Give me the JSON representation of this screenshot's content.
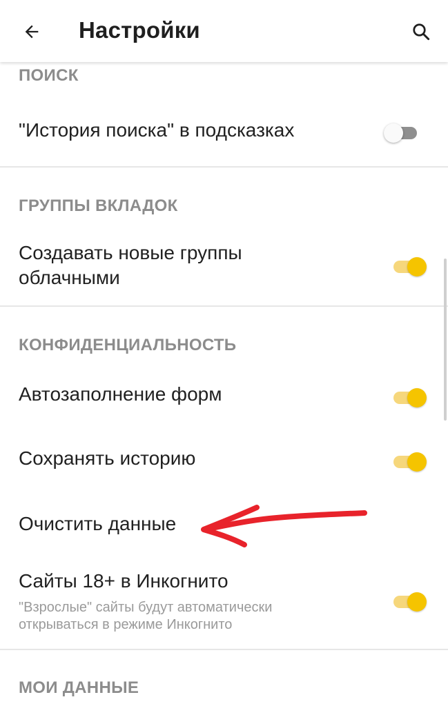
{
  "header": {
    "title": "Настройки",
    "back_icon": "arrow-left-icon",
    "search_icon": "search-icon"
  },
  "sections": {
    "search": {
      "header": "ПОИСК",
      "items": [
        {
          "label": "\"История поиска\" в подсказках",
          "toggle": "off"
        }
      ]
    },
    "tab_groups": {
      "header": "ГРУППЫ ВКЛАДОК",
      "items": [
        {
          "label_line1": "Создавать новые группы",
          "label_line2": "облачными",
          "toggle": "on"
        }
      ]
    },
    "privacy": {
      "header": "КОНФИДЕНЦИАЛЬНОСТЬ",
      "items": [
        {
          "label": "Автозаполнение форм",
          "toggle": "on"
        },
        {
          "label": "Сохранять историю",
          "toggle": "on"
        },
        {
          "label": "Очистить данные"
        },
        {
          "label": "Сайты 18+ в Инкогнито",
          "sub_line1": "\"Взрослые\" сайты будут автоматически",
          "sub_line2": "открываться в режиме Инкогнито",
          "toggle": "on"
        }
      ]
    },
    "my_data": {
      "header": "МОИ ДАННЫЕ"
    }
  },
  "colors": {
    "toggle_on_thumb": "#f5c400",
    "toggle_on_track": "#f6d77c",
    "toggle_off_track": "#8f8f8f",
    "annotation_arrow": "#e8232b",
    "section_header": "#8c8c8c"
  },
  "annotation": {
    "icon": "red-arrow-annotation-icon"
  }
}
